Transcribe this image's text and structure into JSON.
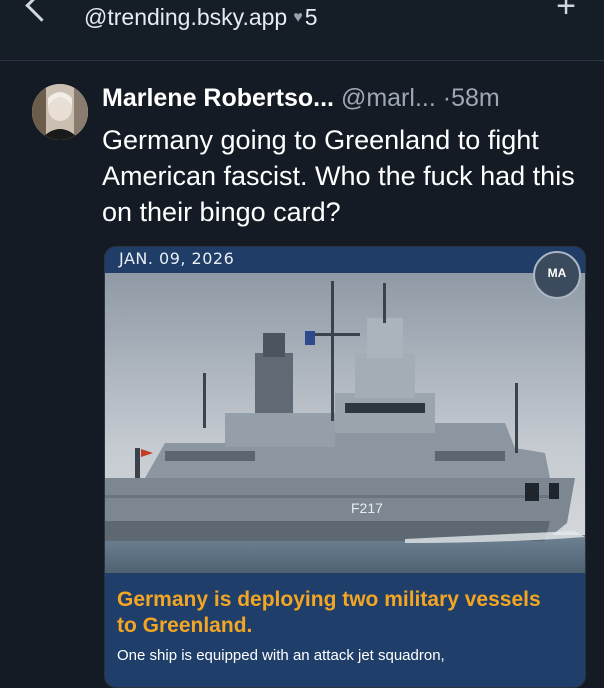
{
  "topbar": {
    "feed_title": "@trending.bsky.app",
    "heart_icon": "heart-icon",
    "like_count": "5"
  },
  "post": {
    "author_name": "Marlene Robertso...",
    "handle": "@marl...",
    "separator": "·",
    "time": "58m",
    "text": "Germany going to Greenland to fight American fascist.  Who the fuck had this on their bingo card?",
    "embed": {
      "date": "JAN. 09, 2026",
      "badge": "MA",
      "hull_number": "F217",
      "headline": "Germany is deploying two military vessels to Greenland.",
      "subline": "One ship is equipped with an attack jet squadron,"
    }
  },
  "colors": {
    "background": "#141b24",
    "accent_headline": "#f4a623",
    "card_blue": "#1f3f6a"
  }
}
